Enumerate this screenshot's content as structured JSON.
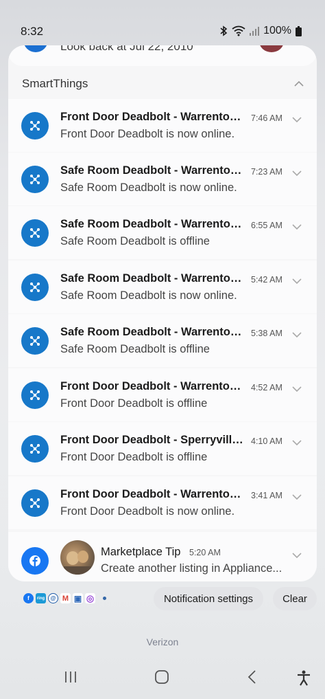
{
  "status": {
    "time": "8:32",
    "battery": "100%"
  },
  "prev_notification": {
    "text": "Look back at Jul 22, 2010"
  },
  "group": {
    "title": "SmartThings"
  },
  "notifications": [
    {
      "title": "Front Door Deadbolt - Warrenton...",
      "time": "7:46 AM",
      "body": "Front Door Deadbolt is now online."
    },
    {
      "title": "Safe Room Deadbolt - Warrenton...",
      "time": "7:23 AM",
      "body": "Safe Room Deadbolt is now online."
    },
    {
      "title": "Safe Room Deadbolt - Warrenton...",
      "time": "6:55 AM",
      "body": "Safe Room Deadbolt is offline"
    },
    {
      "title": "Safe Room Deadbolt - Warrenton...",
      "time": "5:42 AM",
      "body": "Safe Room Deadbolt is now online."
    },
    {
      "title": "Safe Room Deadbolt - Warrenton...",
      "time": "5:38 AM",
      "body": "Safe Room Deadbolt is offline"
    },
    {
      "title": "Front Door Deadbolt - Warrenton...",
      "time": "4:52 AM",
      "body": "Front Door Deadbolt is offline"
    },
    {
      "title": "Front Door Deadbolt - Sperryville...",
      "time": "4:10 AM",
      "body": "Front Door Deadbolt is offline"
    },
    {
      "title": "Front Door Deadbolt - Warrenton...",
      "time": "3:41 AM",
      "body": "Front Door Deadbolt is now online."
    }
  ],
  "marketplace": {
    "title": "Marketplace Tip",
    "time": "5:20 AM",
    "body": "Create another listing in Appliance..."
  },
  "mini_icons": [
    {
      "name": "facebook-icon",
      "glyph": "f",
      "color": "#1877f2"
    },
    {
      "name": "ring-icon",
      "glyph": "ring",
      "color": "#1c9ad6"
    },
    {
      "name": "threads-icon",
      "glyph": "@",
      "color": "#1f5ca8"
    },
    {
      "name": "gmail-icon",
      "glyph": "M",
      "color": "#d94235"
    },
    {
      "name": "gallery-icon",
      "glyph": "▣",
      "color": "#2f68b8"
    },
    {
      "name": "messenger-icon",
      "glyph": "◎",
      "color": "#9b4fd8"
    }
  ],
  "actions": {
    "settings_label": "Notification settings",
    "clear_label": "Clear"
  },
  "carrier": "Verizon",
  "colors": {
    "smartthings_blue": "#1778c9",
    "facebook_blue": "#1877f2"
  }
}
